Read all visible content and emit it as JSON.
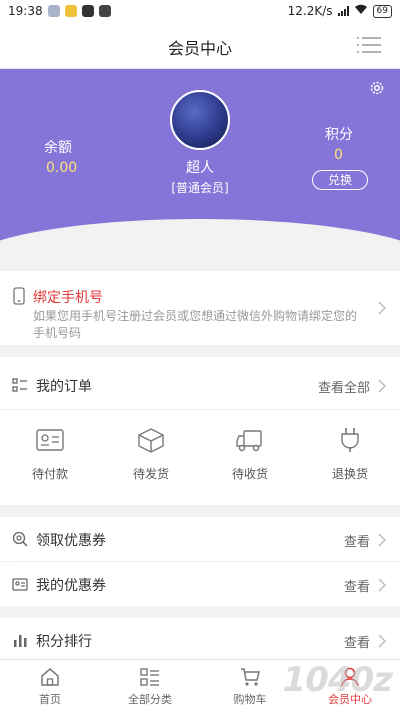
{
  "status_bar": {
    "time": "19:38",
    "network_speed": "12.2K/s",
    "battery": "69"
  },
  "header": {
    "title": "会员中心",
    "menu_icon": "list-menu-icon"
  },
  "profile": {
    "settings_icon": "gear-icon",
    "username": "超人",
    "member_level": "[普通会员]",
    "balance_label": "余额",
    "balance_value": "0.00",
    "points_label": "积分",
    "points_value": "0",
    "exchange_label": "兑换",
    "brand_color": "#8675d8",
    "value_color": "#ffe27a"
  },
  "bind_phone": {
    "title": "绑定手机号",
    "description": "如果您用手机号注册过会员或您想通过微信外购物请绑定您的手机号码",
    "accent_color": "#e03a3a"
  },
  "orders": {
    "title": "我的订单",
    "view_all": "查看全部",
    "items": [
      {
        "label": "待付款",
        "icon": "wallet-card-icon"
      },
      {
        "label": "待发货",
        "icon": "package-box-icon"
      },
      {
        "label": "待收货",
        "icon": "delivery-truck-icon"
      },
      {
        "label": "退换货",
        "icon": "plug-return-icon"
      }
    ]
  },
  "list_rows": [
    {
      "title": "领取优惠券",
      "action": "查看",
      "icon": "coupon-search-icon"
    },
    {
      "title": "我的优惠券",
      "action": "查看",
      "icon": "id-card-icon"
    },
    {
      "title": "积分排行",
      "action": "查看",
      "icon": "bar-chart-icon"
    }
  ],
  "bottom_nav": [
    {
      "label": "首页",
      "icon": "home-icon",
      "active": false
    },
    {
      "label": "全部分类",
      "icon": "category-list-icon",
      "active": false
    },
    {
      "label": "购物车",
      "icon": "cart-icon",
      "active": false
    },
    {
      "label": "会员中心",
      "icon": "user-icon",
      "active": true
    }
  ],
  "watermark": "1040z"
}
